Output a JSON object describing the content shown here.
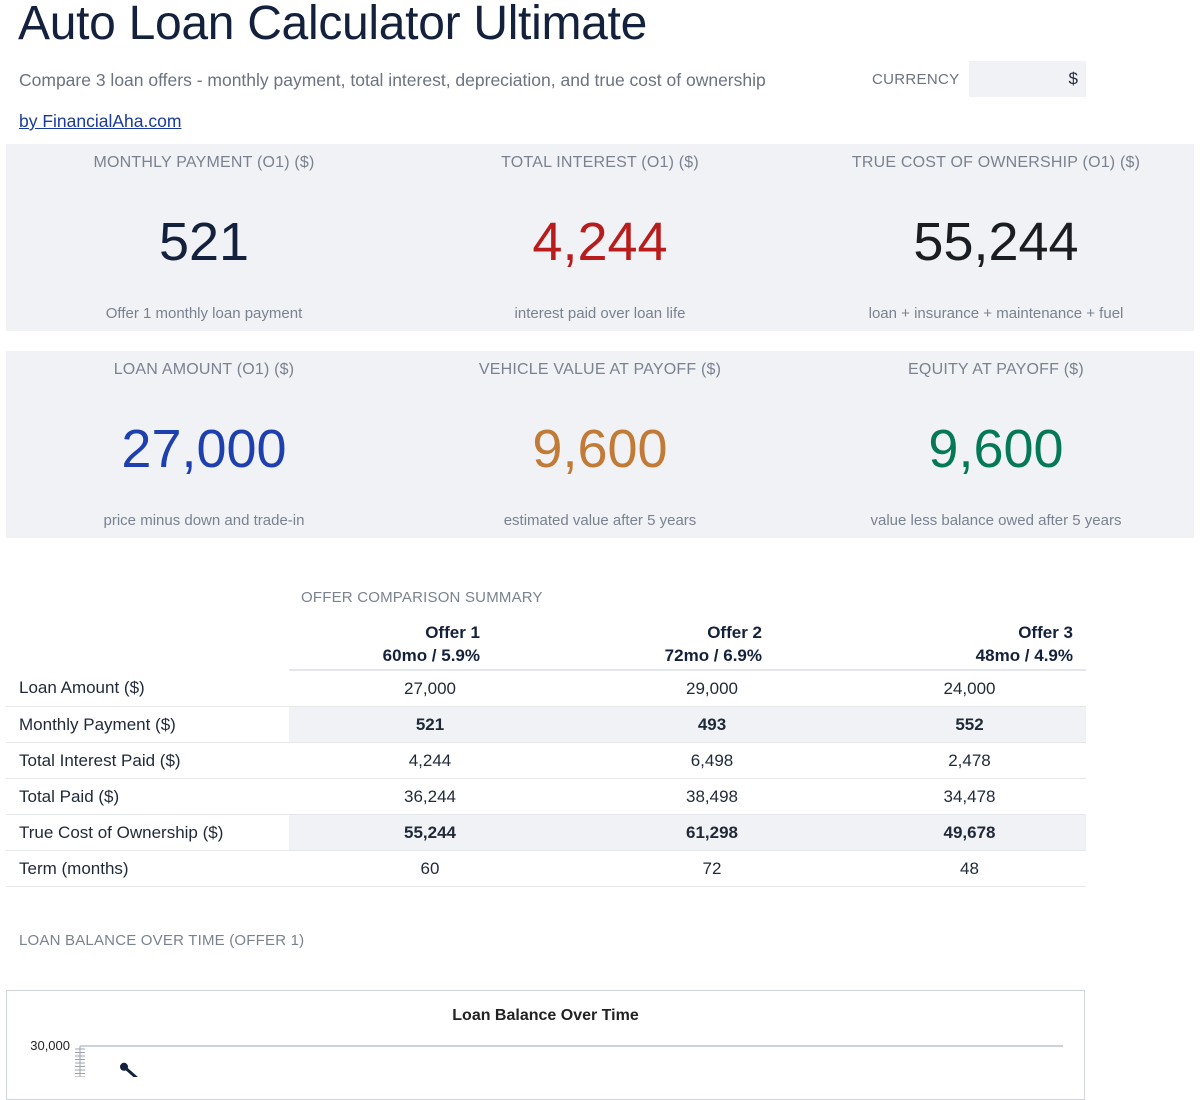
{
  "header": {
    "title": "Auto Loan Calculator Ultimate",
    "subtitle": "Compare 3 loan offers - monthly payment, total interest, depreciation, and true cost of ownership",
    "byline": "by FinancialAha.com",
    "currency_label": "CURRENCY",
    "currency_value": "$"
  },
  "kpis_row1": [
    {
      "label": "MONTHLY PAYMENT (O1) ($)",
      "value": "521",
      "note": "Offer 1 monthly loan payment",
      "color": "#14213d"
    },
    {
      "label": "TOTAL INTEREST (O1) ($)",
      "value": "4,244",
      "note": "interest paid over loan life",
      "color": "#b91c1c"
    },
    {
      "label": "TRUE COST OF OWNERSHIP (O1) ($)",
      "value": "55,244",
      "note": "loan + insurance + maintenance + fuel",
      "color": "#1a1d21"
    }
  ],
  "kpis_row2": [
    {
      "label": "LOAN AMOUNT (O1) ($)",
      "value": "27,000",
      "note": "price minus down and trade-in",
      "color": "#1e40af"
    },
    {
      "label": "VEHICLE VALUE AT PAYOFF ($)",
      "value": "9,600",
      "note": "estimated value after 5 years",
      "color": "#c27a37"
    },
    {
      "label": "EQUITY AT PAYOFF ($)",
      "value": "9,600",
      "note": "value less balance owed after 5 years",
      "color": "#047857"
    }
  ],
  "comparison": {
    "section_title": "OFFER COMPARISON SUMMARY",
    "offers": [
      {
        "name": "Offer 1",
        "terms": "60mo / 5.9%"
      },
      {
        "name": "Offer 2",
        "terms": "72mo / 6.9%"
      },
      {
        "name": "Offer 3",
        "terms": "48mo / 4.9%"
      }
    ],
    "rows": [
      {
        "label": "Loan Amount ($)",
        "values": [
          "27,000",
          "29,000",
          "24,000"
        ]
      },
      {
        "label": "Monthly Payment ($)",
        "values": [
          "521",
          "493",
          "552"
        ]
      },
      {
        "label": "Total Interest Paid ($)",
        "values": [
          "4,244",
          "6,498",
          "2,478"
        ]
      },
      {
        "label": "Total Paid ($)",
        "values": [
          "36,244",
          "38,498",
          "34,478"
        ]
      },
      {
        "label": "True Cost of Ownership ($)",
        "values": [
          "55,244",
          "61,298",
          "49,678"
        ]
      },
      {
        "label": "Term (months)",
        "values": [
          "60",
          "72",
          "48"
        ]
      }
    ]
  },
  "balance": {
    "section_title": "LOAN BALANCE OVER TIME (OFFER 1)",
    "chart_title": "Loan Balance Over Time"
  },
  "chart_data": {
    "type": "line",
    "title": "Loan Balance Over Time",
    "xlabel": "",
    "ylabel": "",
    "y_tick_labels": [
      "30,000"
    ],
    "ylim": [
      0,
      30000
    ],
    "series": [
      {
        "values": [
          27000
        ]
      }
    ],
    "line_color": "#14213d"
  }
}
